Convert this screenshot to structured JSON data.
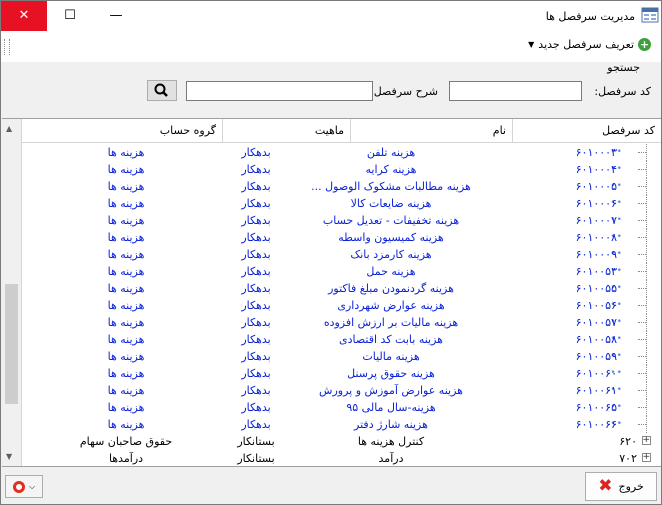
{
  "window": {
    "title": "مدیریت سرفصل ها",
    "close": "✕",
    "maximize": "☐",
    "minimize": "—"
  },
  "toolbar": {
    "new_label": "تعریف سرفصل جدید"
  },
  "search": {
    "legend": "جستجو",
    "code_label": "کد سرفصل:",
    "desc_label": "شرح سرفصل:",
    "code_value": "",
    "desc_value": ""
  },
  "grid": {
    "headers": [
      "کد سرفصل",
      "نام",
      "ماهیت",
      "گروه حساب"
    ],
    "rows": [
      {
        "code": "۶۰۱۰۰۰۳",
        "name": "هزینه تلفن",
        "nature": "بدهکار",
        "group": "هزینه ها"
      },
      {
        "code": "۶۰۱۰۰۰۴",
        "name": "هزینه کرایه",
        "nature": "بدهکار",
        "group": "هزینه ها"
      },
      {
        "code": "۶۰۱۰۰۰۵",
        "name": "هزینه مطالبات مشکوک الوصول ...",
        "nature": "بدهکار",
        "group": "هزینه ها"
      },
      {
        "code": "۶۰۱۰۰۰۶",
        "name": "هزینه ضایعات کالا",
        "nature": "بدهکار",
        "group": "هزینه ها"
      },
      {
        "code": "۶۰۱۰۰۰۷",
        "name": "هزینه تخفیفات - تعدیل حساب",
        "nature": "بدهکار",
        "group": "هزینه ها"
      },
      {
        "code": "۶۰۱۰۰۰۸",
        "name": "هزینه کمیسیون واسطه",
        "nature": "بدهکار",
        "group": "هزینه ها"
      },
      {
        "code": "۶۰۱۰۰۰۹",
        "name": "هزینه کارمزد بانک",
        "nature": "بدهکار",
        "group": "هزینه ها"
      },
      {
        "code": "۶۰۱۰۰۵۳",
        "name": "هزینه حمل",
        "nature": "بدهکار",
        "group": "هزینه ها"
      },
      {
        "code": "۶۰۱۰۰۵۵",
        "name": "هزینه گردنمودن مبلغ فاکتور",
        "nature": "بدهکار",
        "group": "هزینه ها"
      },
      {
        "code": "۶۰۱۰۰۵۶",
        "name": "هزینه عوارض شهرداری",
        "nature": "بدهکار",
        "group": "هزینه ها"
      },
      {
        "code": "۶۰۱۰۰۵۷",
        "name": "هزینه مالیات بر ارزش افزوده",
        "nature": "بدهکار",
        "group": "هزینه ها"
      },
      {
        "code": "۶۰۱۰۰۵۸",
        "name": "هزینه بابت کد اقتصادی",
        "nature": "بدهکار",
        "group": "هزینه ها"
      },
      {
        "code": "۶۰۱۰۰۵۹",
        "name": "هزینه مالیات",
        "nature": "بدهکار",
        "group": "هزینه ها"
      },
      {
        "code": "۶۰۱۰۰۶۰",
        "name": "هزینه حقوق پرسنل",
        "nature": "بدهکار",
        "group": "هزینه ها"
      },
      {
        "code": "۶۰۱۰۰۶۱",
        "name": "هزینه عوارض آموزش و پرورش",
        "nature": "بدهکار",
        "group": "هزینه ها"
      },
      {
        "code": "۶۰۱۰۰۶۵",
        "name": "هزینه-سال مالی ۹۵",
        "nature": "بدهکار",
        "group": "هزینه ها"
      },
      {
        "code": "۶۰۱۰۰۶۶",
        "name": "هزینه شارژ دفتر",
        "nature": "بدهکار",
        "group": "هزینه ها"
      }
    ],
    "parents": [
      {
        "code": "۶۲۰",
        "name": "کنترل هزینه ها",
        "nature": "بستانکار",
        "group": "حقوق صاحبان سهام"
      },
      {
        "code": "۷۰۲",
        "name": "درآمد",
        "nature": "بستانکار",
        "group": "درآمدها"
      }
    ]
  },
  "footer": {
    "exit_label": "خروج"
  }
}
